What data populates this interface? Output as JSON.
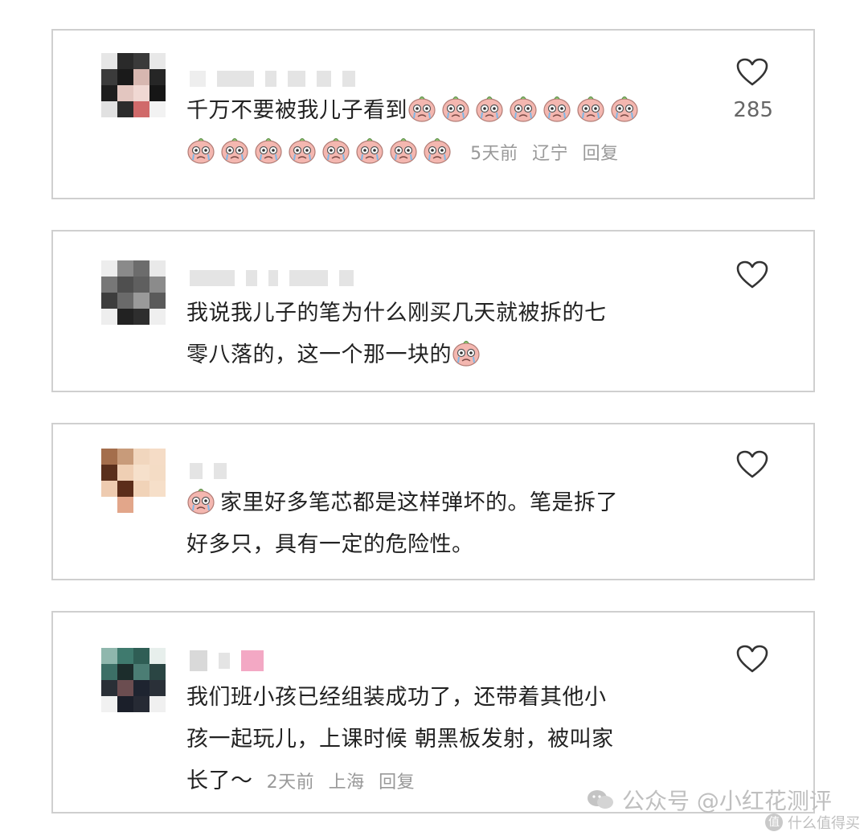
{
  "comments": [
    {
      "text": "千万不要被我儿子看到",
      "emoji_count_inline": 7,
      "emoji_count_line2": 8,
      "time": "5天前",
      "location": "辽宁",
      "reply": "回复",
      "likes": "285"
    },
    {
      "text_line1": "我说我儿子的笔为什么刚买几天就被拆的七",
      "text_line2": "零八落的，这一个那一块的"
    },
    {
      "text_line1": "家里好多笔芯都是这样弹坏的。笔是拆了",
      "text_line2": "好多只，具有一定的危险性。"
    },
    {
      "text_line1": "我们班小孩已经组装成功了，还带着其他小",
      "text_line2": "孩一起玩儿，上课时候 朝黑板发射，被叫家",
      "text_line3": "长了～",
      "time": "2天前",
      "location": "上海",
      "reply": "回复"
    }
  ],
  "watermark": {
    "text": "公众号 @小红花测评",
    "icon": "wechat-icon"
  },
  "smzdm": {
    "text": "什么值得买",
    "icon": "smzdm-logo-icon"
  },
  "icons": {
    "like": "heart-outline-icon",
    "emoji": "crying-face-emoji-icon"
  },
  "colors": {
    "border": "#cfcfcf",
    "text": "#222222",
    "meta": "#999999",
    "emoji_face": "#f4b7b0"
  }
}
